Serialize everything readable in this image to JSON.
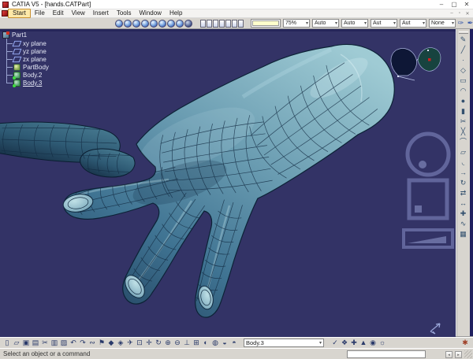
{
  "window": {
    "title": "CATIA V5 - [hands.CATPart]",
    "controls": [
      {
        "name": "minimize-button",
        "glyph": "–"
      },
      {
        "name": "maximize-button",
        "glyph": "▢"
      },
      {
        "name": "close-button",
        "glyph": "✕"
      }
    ],
    "doc_controls": [
      {
        "name": "doc-minimize-button",
        "glyph": "–"
      },
      {
        "name": "doc-restore-button",
        "glyph": "▫"
      },
      {
        "name": "doc-close-button",
        "glyph": "✕"
      }
    ]
  },
  "menu_bar": {
    "items": [
      {
        "name": "start-menu",
        "label": "Start"
      },
      {
        "name": "file-menu",
        "label": "File"
      },
      {
        "name": "edit-menu",
        "label": "Edit"
      },
      {
        "name": "view-menu",
        "label": "View"
      },
      {
        "name": "insert-menu",
        "label": "Insert"
      },
      {
        "name": "tools-menu",
        "label": "Tools"
      },
      {
        "name": "window-menu",
        "label": "Window"
      },
      {
        "name": "help-menu",
        "label": "Help"
      }
    ]
  },
  "graphic_toolbar": {
    "view_icons": [
      {
        "name": "shading-icon"
      },
      {
        "name": "shading-edges-icon"
      },
      {
        "name": "shading-hidden-edges-icon"
      },
      {
        "name": "wireframe-icon"
      },
      {
        "name": "dynamic-hlr-icon"
      },
      {
        "name": "materials-view-icon"
      },
      {
        "name": "perspective-view-icon"
      },
      {
        "name": "lighting-icon"
      },
      {
        "name": "custom-view-icon"
      }
    ],
    "style_icons": [
      {
        "name": "painter-style-1-icon"
      },
      {
        "name": "painter-style-2-icon"
      },
      {
        "name": "painter-style-3-icon"
      },
      {
        "name": "painter-style-4-icon"
      },
      {
        "name": "painter-style-5-icon"
      },
      {
        "name": "painter-style-6-icon"
      },
      {
        "name": "painter-style-7-icon"
      }
    ],
    "color_swatch": "#ffffcc",
    "combos": [
      {
        "name": "transparency-select",
        "value": "75%"
      },
      {
        "name": "linetype-select",
        "value": "Auto"
      },
      {
        "name": "line-weight-select",
        "value": "Auto"
      },
      {
        "name": "point-symbol-select",
        "value": "Aut"
      },
      {
        "name": "render-style-select",
        "value": "Aut"
      },
      {
        "name": "layer-select",
        "value": "None"
      }
    ],
    "tail_icons": [
      {
        "name": "graphic-painter-icon",
        "glyph": "✑"
      },
      {
        "name": "graphic-wizard-icon",
        "glyph": "✒"
      }
    ]
  },
  "tree": {
    "root": {
      "name": "tree-root-part1",
      "label": "Part1",
      "icon": "part-icon"
    },
    "items": [
      {
        "name": "tree-item-xy-plane",
        "label": "xy plane",
        "icon": "plane-icon"
      },
      {
        "name": "tree-item-yz-plane",
        "label": "yz plane",
        "icon": "plane-icon"
      },
      {
        "name": "tree-item-zx-plane",
        "label": "zx plane",
        "icon": "plane-icon"
      },
      {
        "name": "tree-item-partbody",
        "label": "PartBody",
        "icon": "partbody-icon"
      },
      {
        "name": "tree-item-body2",
        "label": "Body.2",
        "icon": "body-icon"
      },
      {
        "name": "tree-item-body3",
        "label": "Body.3",
        "icon": "body-icon"
      }
    ]
  },
  "viewport": {
    "background": "#333366",
    "model": "hand surface model"
  },
  "right_toolbar": {
    "icons": [
      {
        "name": "sketcher-icon",
        "glyph": "✎"
      },
      {
        "name": "line-icon",
        "glyph": "╱"
      },
      {
        "name": "point-icon",
        "glyph": "∙"
      },
      {
        "name": "plane-tool-icon",
        "glyph": "◇"
      },
      {
        "name": "extrude-icon",
        "glyph": "▭"
      },
      {
        "name": "revolve-icon",
        "glyph": "◠"
      },
      {
        "name": "sphere-icon",
        "glyph": "●"
      },
      {
        "name": "cylinder-icon",
        "glyph": "▮"
      },
      {
        "name": "split-icon",
        "glyph": "✂"
      },
      {
        "name": "trim-icon",
        "glyph": "╳"
      },
      {
        "name": "boundary-icon",
        "glyph": "⌒"
      },
      {
        "name": "extract-icon",
        "glyph": "▱"
      },
      {
        "name": "fillet-icon",
        "glyph": "◟"
      },
      {
        "name": "translate-icon",
        "glyph": "→"
      },
      {
        "name": "rotate-tool-icon",
        "glyph": "↻"
      },
      {
        "name": "symmetry-icon",
        "glyph": "⇄"
      },
      {
        "name": "scaling-icon",
        "glyph": "↔"
      },
      {
        "name": "join-icon",
        "glyph": "✚"
      },
      {
        "name": "freestyle-surface-icon",
        "glyph": "∿"
      },
      {
        "name": "shape-analysis-icon",
        "glyph": "▦"
      }
    ]
  },
  "bottom_toolbar": {
    "icons": [
      {
        "name": "new-file-icon",
        "glyph": "▯"
      },
      {
        "name": "open-file-icon",
        "glyph": "▱"
      },
      {
        "name": "save-icon",
        "glyph": "▣"
      },
      {
        "name": "print-icon",
        "glyph": "▤"
      },
      {
        "name": "cut-icon",
        "glyph": "✂"
      },
      {
        "name": "copy-icon",
        "glyph": "▥"
      },
      {
        "name": "paste-icon",
        "glyph": "▨"
      },
      {
        "name": "undo-icon",
        "glyph": "↶"
      },
      {
        "name": "redo-icon",
        "glyph": "↷"
      },
      {
        "name": "link-icon",
        "glyph": "∾"
      },
      {
        "name": "bookmark-icon",
        "glyph": "⚑"
      },
      {
        "name": "selection-icon",
        "glyph": "◆"
      },
      {
        "name": "catalog-icon",
        "glyph": "◈"
      },
      {
        "name": "fly-mode-icon",
        "glyph": "✈"
      },
      {
        "name": "fit-all-in-icon",
        "glyph": "⊡"
      },
      {
        "name": "pan-icon",
        "glyph": "✛"
      },
      {
        "name": "rotate-view-icon",
        "glyph": "↻"
      },
      {
        "name": "zoom-in-icon",
        "glyph": "⊕"
      },
      {
        "name": "zoom-out-icon",
        "glyph": "⊖"
      },
      {
        "name": "normal-view-icon",
        "glyph": "⊥"
      },
      {
        "name": "multi-view-icon",
        "glyph": "⊞"
      },
      {
        "name": "shading-mode-icon",
        "glyph": "◐"
      },
      {
        "name": "wireframe-mode-icon",
        "glyph": "◍"
      },
      {
        "name": "hide-show-icon",
        "glyph": "◒"
      },
      {
        "name": "swap-space-icon",
        "glyph": "◓"
      }
    ],
    "body_combo": {
      "name": "in-work-object-select",
      "value": "Body.3"
    },
    "right_icons": [
      {
        "name": "apply-icon",
        "glyph": "✓"
      },
      {
        "name": "knowledge-icon",
        "glyph": "❖"
      },
      {
        "name": "formula-icon",
        "glyph": "✚"
      },
      {
        "name": "measure-icon",
        "glyph": "▲"
      },
      {
        "name": "annotation-icon",
        "glyph": "◉"
      },
      {
        "name": "render-tools-icon",
        "glyph": "☼"
      }
    ],
    "far_icon": {
      "name": "power-copy-icon",
      "glyph": "✱"
    }
  },
  "status_bar": {
    "message": "Select an object or a command",
    "command_input": ""
  }
}
